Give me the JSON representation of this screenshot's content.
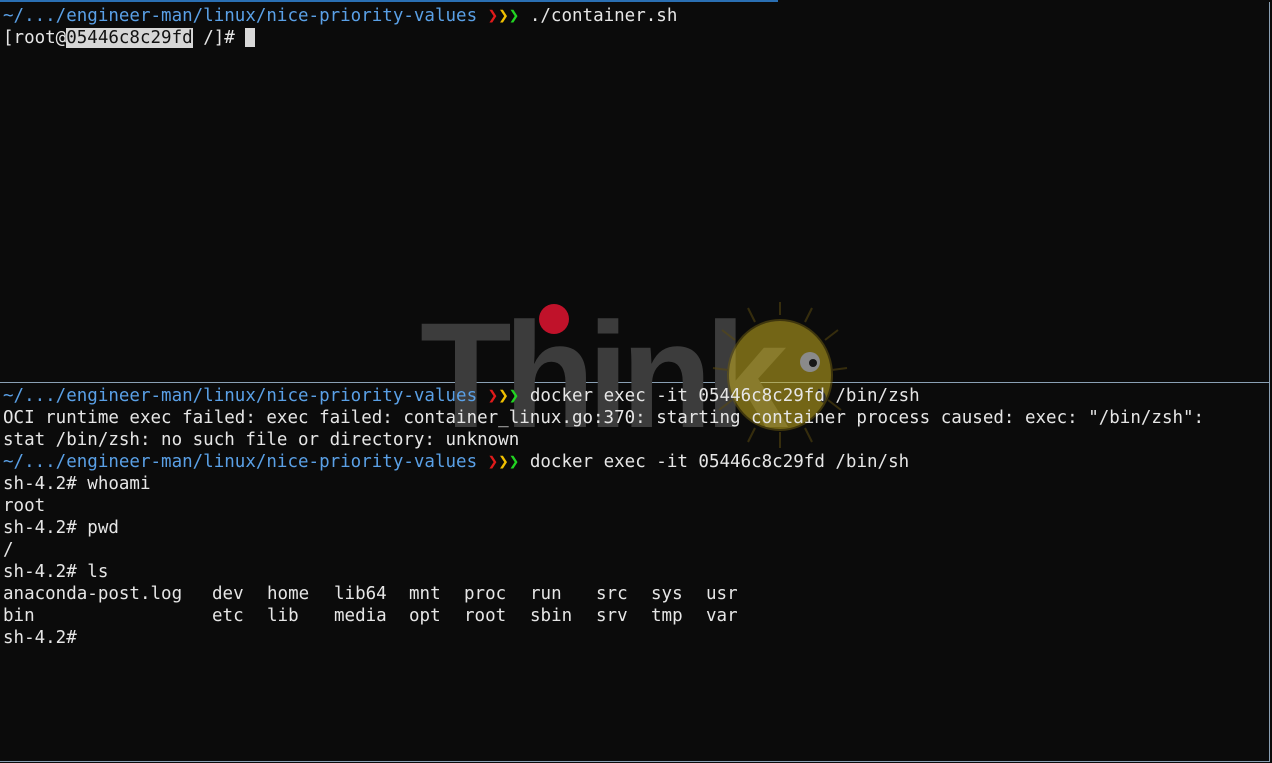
{
  "theme": {
    "background": "#0b0b0b",
    "foreground": "#e6e6e6",
    "path_color": "#5aa0e6",
    "chevron_colors": [
      "#e01b1b",
      "#f0c000",
      "#22d422"
    ],
    "divider_color": "#8aa0b4"
  },
  "top_pane": {
    "prompt": {
      "path": "~/.../engineer-man/linux/nice-priority-values",
      "command": " ./container.sh"
    },
    "shell_line": {
      "prefix": "[root@",
      "host": "05446c8c29fd",
      "suffix": " /]# "
    }
  },
  "bottom_pane": {
    "prompt1": {
      "path": "~/.../engineer-man/linux/nice-priority-values",
      "command": " docker exec -it 05446c8c29fd /bin/zsh"
    },
    "error_line1": "OCI runtime exec failed: exec failed: container_linux.go:370: starting container process caused: exec: \"/bin/zsh\":",
    "error_line2": "stat /bin/zsh: no such file or directory: unknown",
    "prompt2": {
      "path": "~/.../engineer-man/linux/nice-priority-values",
      "command": " docker exec -it 05446c8c29fd /bin/sh"
    },
    "cmd_whoami": "sh-4.2# whoami",
    "out_whoami": "root",
    "cmd_pwd": "sh-4.2# pwd",
    "out_pwd": "/",
    "cmd_ls": "sh-4.2# ls",
    "ls_row1": [
      "anaconda-post.log",
      "dev",
      "home",
      "lib64",
      "mnt",
      "proc",
      "run",
      "src",
      "sys",
      "usr"
    ],
    "ls_row2": [
      "bin",
      "etc",
      "lib",
      "media",
      "opt",
      "root",
      "sbin",
      "srv",
      "tmp",
      "var"
    ],
    "final_prompt": "sh-4.2#"
  },
  "watermark": {
    "logo_text": "Think",
    "mascot_icon": "pufferfish-icon"
  }
}
